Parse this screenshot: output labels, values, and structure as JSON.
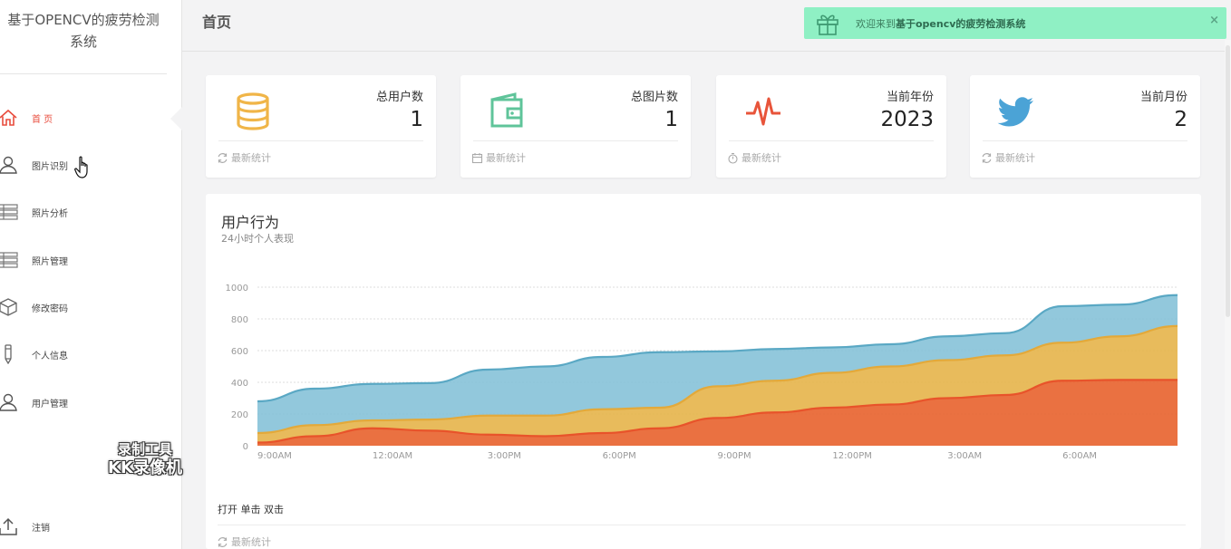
{
  "sidebar": {
    "brand": [
      "基于OPENCV的疲劳检测",
      "系统"
    ],
    "items": [
      {
        "label": "首 页",
        "icon": "home-icon",
        "active": true
      },
      {
        "label": "图片识别",
        "icon": "user-icon",
        "active": false
      },
      {
        "label": "照片分析",
        "icon": "list-icon",
        "active": false
      },
      {
        "label": "照片管理",
        "icon": "list-icon",
        "active": false
      },
      {
        "label": "修改密码",
        "icon": "cube-icon",
        "active": false
      },
      {
        "label": "个人信息",
        "icon": "pen-icon",
        "active": false
      },
      {
        "label": "用户管理",
        "icon": "user-icon",
        "active": false
      }
    ],
    "logout": {
      "label": "注销",
      "icon": "upload-icon"
    },
    "watermark": [
      "录制工具",
      "KK录像机"
    ]
  },
  "header": {
    "title": "首页",
    "toast": {
      "prefix": "欢迎来到",
      "bold": "基于opencv的疲劳检测系统",
      "close": "×"
    }
  },
  "cards": [
    {
      "label": "总用户数",
      "value": "1",
      "foot": "最新统计",
      "icon": "database-icon",
      "foot_icon": "refresh-icon",
      "color": "#f0b548"
    },
    {
      "label": "总图片数",
      "value": "1",
      "foot": "最新统计",
      "icon": "wallet-icon",
      "foot_icon": "calendar-icon",
      "color": "#5fc49a"
    },
    {
      "label": "当前年份",
      "value": "2023",
      "foot": "最新统计",
      "icon": "pulse-icon",
      "foot_icon": "stopwatch-icon",
      "color": "#e8543a"
    },
    {
      "label": "当前月份",
      "value": "2",
      "foot": "最新统计",
      "icon": "twitter-icon",
      "foot_icon": "refresh-icon",
      "color": "#4ba3d6"
    }
  ],
  "panel": {
    "title": "用户行为",
    "subtitle": "24小时个人表现",
    "text": "打开 单击 双击",
    "foot": "最新统计"
  },
  "chart_data": {
    "type": "area",
    "stacked": true,
    "x": [
      0,
      1,
      2,
      3,
      4,
      5,
      6,
      7,
      8,
      9,
      10,
      11,
      12,
      13,
      14,
      15,
      16
    ],
    "x_ticks": [
      "9:00AM",
      "12:00AM",
      "3:00PM",
      "6:00PM",
      "9:00PM",
      "12:00PM",
      "3:00AM",
      "6:00AM"
    ],
    "ylim": [
      0,
      1000
    ],
    "y_ticks": [
      0,
      200,
      400,
      600,
      800,
      1000
    ],
    "grid": true,
    "series": [
      {
        "color": "#e8622c",
        "values": [
          20,
          60,
          110,
          95,
          70,
          60,
          80,
          110,
          175,
          210,
          240,
          260,
          300,
          320,
          410,
          415,
          415
        ]
      },
      {
        "color": "#e6b44a",
        "values": [
          60,
          70,
          50,
          70,
          120,
          130,
          150,
          130,
          200,
          200,
          220,
          240,
          240,
          250,
          240,
          275,
          340
        ]
      },
      {
        "color": "#86c2d8",
        "values": [
          200,
          230,
          230,
          230,
          290,
          310,
          330,
          350,
          220,
          200,
          160,
          140,
          150,
          140,
          230,
          200,
          195
        ]
      }
    ]
  }
}
